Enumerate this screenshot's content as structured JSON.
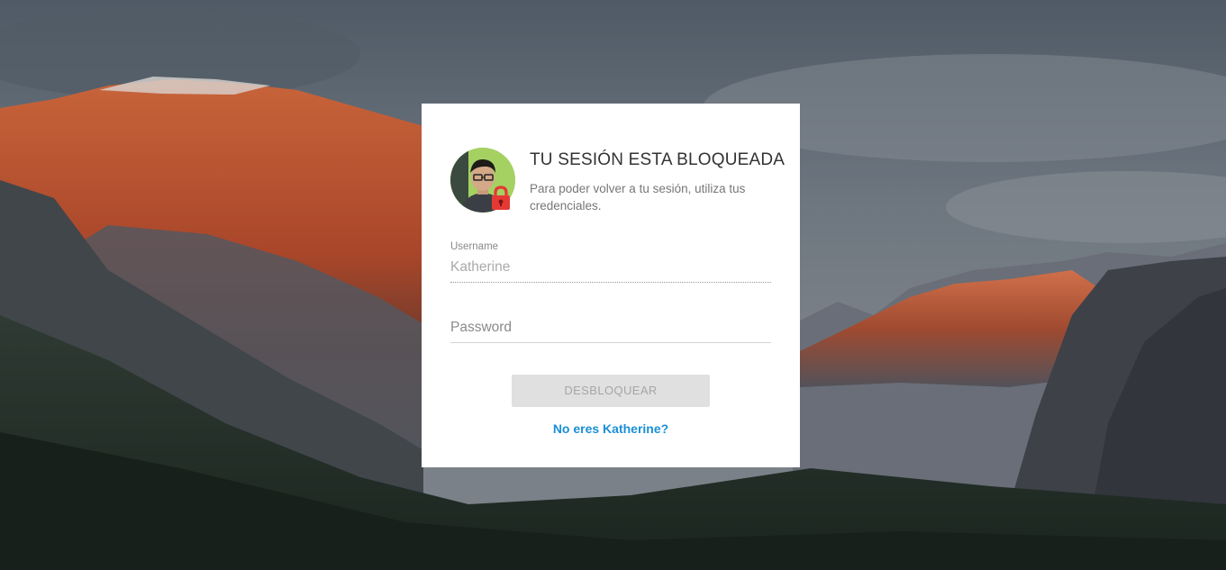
{
  "lock_screen": {
    "title": "TU SESIÓN ESTA BLOQUEADA",
    "subtitle": "Para poder volver a tu sesión, utiliza tus credenciales.",
    "username_label": "Username",
    "username_value": "Katherine",
    "password_placeholder": "Password",
    "unlock_button": "DESBLOQUEAR",
    "not_you_link": "No eres Katherine?"
  },
  "icons": {
    "avatar": "user-avatar",
    "lock": "lock-icon"
  },
  "colors": {
    "link": "#1a8fd8",
    "lock_badge": "#e53935",
    "button_bg": "#e0e0e0",
    "button_text": "#a6a6a6"
  }
}
